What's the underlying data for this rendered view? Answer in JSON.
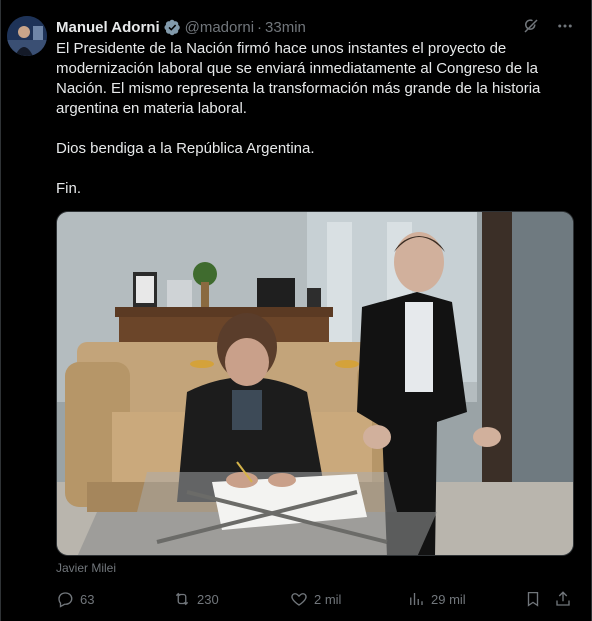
{
  "tweet": {
    "author_name": "Manuel Adorni",
    "handle": "@madorni",
    "separator": "·",
    "time": "33min",
    "paragraphs": [
      "El Presidente de la Nación firmó hace unos instantes el proyecto de modernización laboral que se enviará inmediatamente al Congreso de la Nación. El mismo representa la transformación más grande de la historia argentina en materia laboral.",
      "Dios bendiga a la República Argentina.",
      "Fin."
    ],
    "tagged_person": "Javier Milei"
  },
  "stats": {
    "replies": "63",
    "reposts": "230",
    "likes": "2 mil",
    "views": "29 mil"
  },
  "icons": {
    "verified": "verified-badge-icon",
    "grok": "grok-icon",
    "more": "more-icon",
    "reply": "reply-icon",
    "repost": "repost-icon",
    "like": "like-icon",
    "views": "views-icon",
    "bookmark": "bookmark-icon",
    "share": "share-icon"
  },
  "colors": {
    "background": "#000000",
    "text": "#e7e9ea",
    "muted": "#71767b",
    "verified": "#829aab"
  }
}
